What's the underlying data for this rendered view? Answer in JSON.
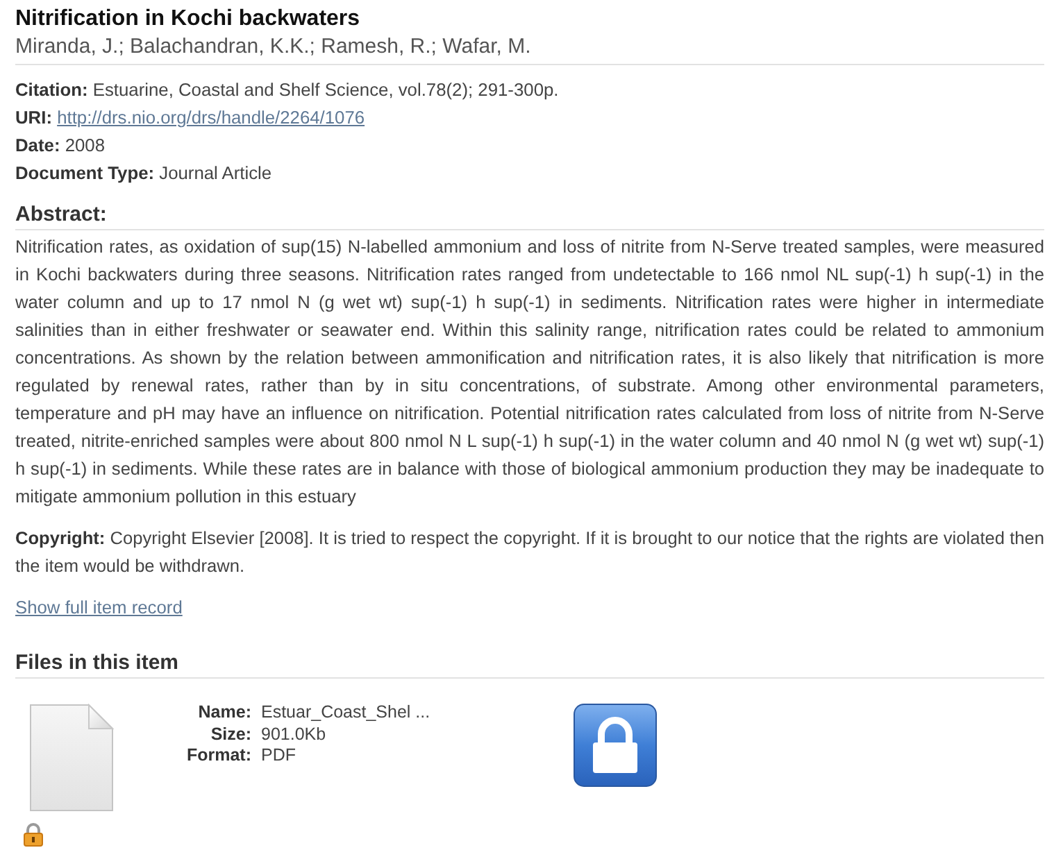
{
  "record": {
    "title": "Nitrification in Kochi backwaters",
    "authors": "Miranda, J.; Balachandran, K.K.; Ramesh, R.; Wafar, M."
  },
  "fields": [
    {
      "kind": "text",
      "label": "Citation:",
      "value": "Estuarine, Coastal and Shelf Science, vol.78(2); 291-300p."
    },
    {
      "kind": "link",
      "label": "URI:",
      "value": "http://drs.nio.org/drs/handle/2264/1076"
    },
    {
      "kind": "text",
      "label": "Date:",
      "value": "2008"
    },
    {
      "kind": "text",
      "label": "Document Type:",
      "value": "Journal Article"
    }
  ],
  "abstract": {
    "heading": "Abstract:",
    "text": "Nitrification rates, as oxidation of sup(15) N-labelled ammonium and loss of nitrite from N-Serve treated samples, were measured in Kochi backwaters during three seasons. Nitrification rates ranged from undetectable to 166 nmol NL sup(-1) h sup(-1) in the water column and up to 17 nmol N (g wet wt) sup(-1) h sup(-1) in sediments. Nitrification rates were higher in intermediate salinities than in either freshwater or seawater end. Within this salinity range, nitrification rates could be related to ammonium concentrations. As shown by the relation between ammonification and nitrification rates, it is also likely that nitrification is more regulated by renewal rates, rather than by in situ concentrations, of substrate. Among other environmental parameters, temperature and pH may have an influence on nitrification. Potential nitrification rates calculated from loss of nitrite from N-Serve treated, nitrite-enriched samples were about 800 nmol N L sup(-1) h sup(-1) in the water column and 40 nmol N (g wet wt) sup(-1) h sup(-1) in sediments. While these rates are in balance with those of biological ammonium production they may be inadequate to mitigate ammonium pollution in this estuary"
  },
  "copyright": "**Copyright:** Copyright Elsevier [2008]. It is tried to respect the copyright. If it is brought to our notice that the rights are violated then the item would be withdrawn.",
  "full_record_link": "Show full item record",
  "files": {
    "heading": "Files in this item",
    "items": [
      {
        "details": [
          {
            "label": "Name:",
            "value": "Estuar_Coast_Shel ..."
          },
          {
            "label": "Size:",
            "value": "901.0Kb"
          },
          {
            "label": "Format:",
            "value": "PDF"
          }
        ]
      }
    ]
  }
}
